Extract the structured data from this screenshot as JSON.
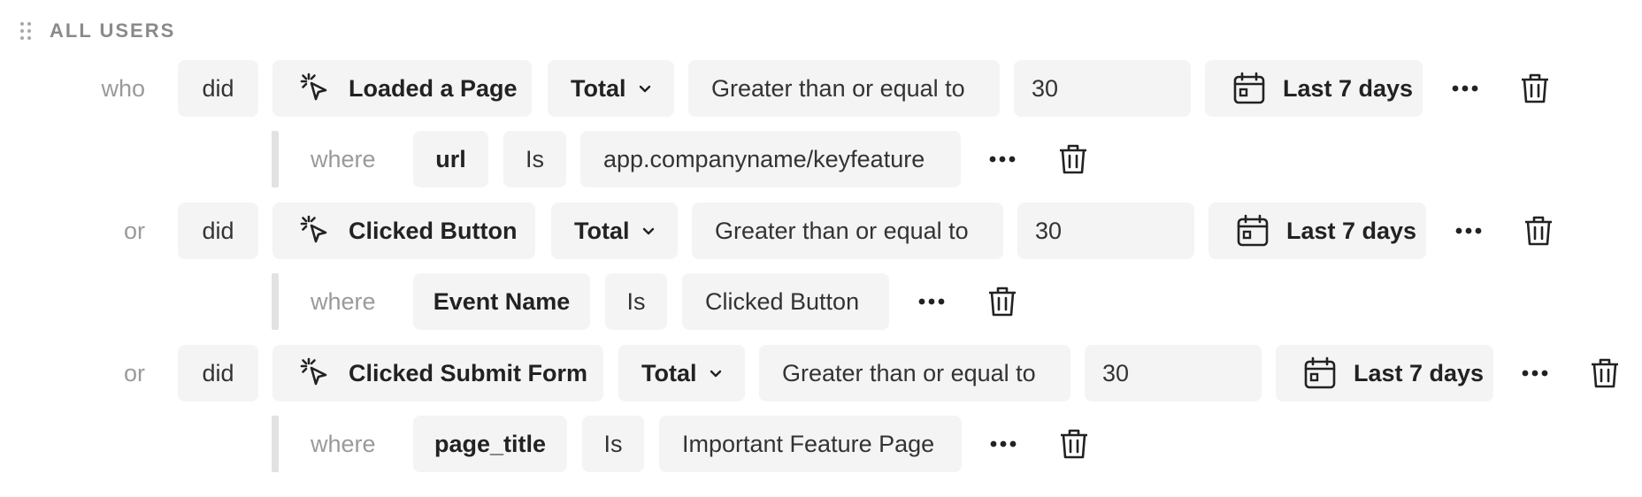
{
  "header": {
    "title": "ALL USERS"
  },
  "rows": [
    {
      "label": "who",
      "did": "did",
      "event": "Loaded a Page",
      "aggregate": "Total",
      "operator": "Greater than or equal to",
      "value": "30",
      "period": "Last 7 days",
      "filter": {
        "where": "where",
        "property": "url",
        "op": "Is",
        "value": "app.companyname/keyfeature"
      }
    },
    {
      "label": "or",
      "did": "did",
      "event": "Clicked Button",
      "aggregate": "Total",
      "operator": "Greater than or equal to",
      "value": "30",
      "period": "Last 7 days",
      "filter": {
        "where": "where",
        "property": "Event Name",
        "op": "Is",
        "value": "Clicked Button"
      }
    },
    {
      "label": "or",
      "did": "did",
      "event": "Clicked Submit Form",
      "aggregate": "Total",
      "operator": "Greater than or equal to",
      "value": "30",
      "period": "Last 7 days",
      "filter": {
        "where": "where",
        "property": "page_title",
        "op": "Is",
        "value": "Important Feature Page"
      }
    }
  ],
  "icons": {
    "drag": "drag-handle-icon",
    "event": "cursor-click-icon",
    "dropdown": "chevron-down-icon",
    "calendar": "calendar-icon",
    "more": "more-horizontal-icon",
    "delete": "trash-icon"
  },
  "colors": {
    "chip_bg": "#f4f4f4",
    "muted_text": "#9a9a9a",
    "header_text": "#8a8a8a",
    "sub_bar": "#e2e2e2"
  }
}
